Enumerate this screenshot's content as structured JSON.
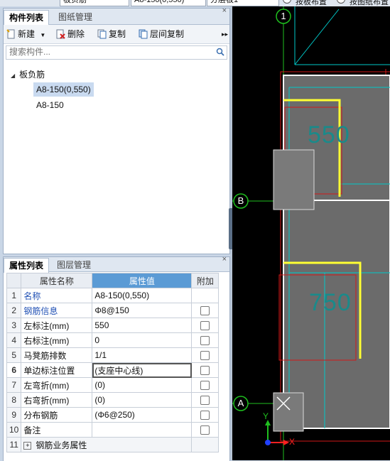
{
  "top_toolbar": {
    "combo1": "板负筋",
    "combo2": "A8-150(0,550)",
    "combo3": "分层板1",
    "radio1": "按板布置",
    "radio2": "按图纸布置"
  },
  "component_panel": {
    "tabs": [
      "构件列表",
      "图纸管理"
    ],
    "toolbar": {
      "new": "新建",
      "delete": "删除",
      "copy": "复制",
      "floor_copy": "层间复制"
    },
    "search_placeholder": "搜索构件...",
    "tree": {
      "root": "板负筋",
      "children": [
        "A8-150(0,550)",
        "A8-150"
      ]
    }
  },
  "property_panel": {
    "tabs": [
      "属性列表",
      "图层管理"
    ],
    "headers": {
      "name": "属性名称",
      "value": "属性值",
      "extra": "附加"
    },
    "rows": [
      {
        "num": "1",
        "name": "名称",
        "value": "A8-150(0,550)"
      },
      {
        "num": "2",
        "name": "钢筋信息",
        "value": "Φ8@150"
      },
      {
        "num": "3",
        "name": "左标注(mm)",
        "value": "550"
      },
      {
        "num": "4",
        "name": "右标注(mm)",
        "value": "0"
      },
      {
        "num": "5",
        "name": "马凳筋排数",
        "value": "1/1"
      },
      {
        "num": "6",
        "name": "单边标注位置",
        "value": "(支座中心线)"
      },
      {
        "num": "7",
        "name": "左弯折(mm)",
        "value": "(0)"
      },
      {
        "num": "8",
        "name": "右弯折(mm)",
        "value": "(0)"
      },
      {
        "num": "9",
        "name": "分布钢筋",
        "value": "(Φ6@250)"
      },
      {
        "num": "10",
        "name": "备注",
        "value": ""
      },
      {
        "num": "11",
        "name": "钢筋业务属性",
        "value": ""
      }
    ]
  },
  "canvas": {
    "axis_top": "1",
    "axis_b": "B",
    "axis_a": "A",
    "dim_550": "550",
    "dim_750": "750",
    "ucs_x": "X",
    "ucs_y": "Y"
  },
  "colors": {
    "canvas_bg": "#000000",
    "slab_fill": "#6b6b6b",
    "rebar_yellow": "#ffff33",
    "cyan": "#00c8c8",
    "red": "#d01818",
    "green_axis": "#1fbf1f"
  }
}
